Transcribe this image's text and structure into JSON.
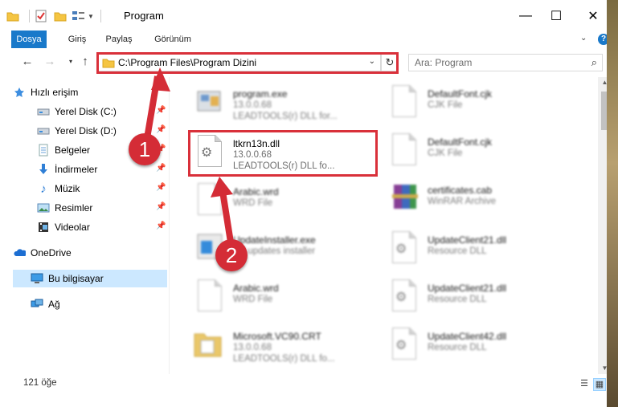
{
  "window": {
    "title": "Program",
    "controls": {
      "minimize": "—",
      "maximize": "☐",
      "close": "✕"
    }
  },
  "ribbon": {
    "tabs": [
      {
        "label": "Dosya",
        "active": true
      },
      {
        "label": "Giriş"
      },
      {
        "label": "Paylaş"
      },
      {
        "label": "Görünüm"
      }
    ],
    "expand_icon": "chevron-down-icon",
    "help_icon": "help-icon"
  },
  "nav": {
    "address": "C:\\Program Files\\Program Dizini",
    "search_placeholder": "Ara: Program"
  },
  "sidebar": {
    "items": [
      {
        "label": "Hızlı erişim",
        "icon": "star-icon"
      },
      {
        "label": "Yerel Disk (C:)",
        "icon": "drive-icon",
        "pinned": true
      },
      {
        "label": "Yerel Disk (D:)",
        "icon": "drive-icon",
        "pinned": true
      },
      {
        "label": "Belgeler",
        "icon": "documents-icon",
        "pinned": true
      },
      {
        "label": "İndirmeler",
        "icon": "download-icon",
        "pinned": true
      },
      {
        "label": "Müzik",
        "icon": "music-icon",
        "pinned": true
      },
      {
        "label": "Resimler",
        "icon": "pictures-icon",
        "pinned": true
      },
      {
        "label": "Videolar",
        "icon": "videos-icon",
        "pinned": true
      },
      {
        "label": "OneDrive",
        "icon": "cloud-icon"
      },
      {
        "label": "Bu bilgisayar",
        "icon": "computer-icon",
        "selected": true
      },
      {
        "label": "Ağ",
        "icon": "network-icon"
      }
    ]
  },
  "files": {
    "left": [
      {
        "name": "program.exe",
        "line2": "13.0.0.68",
        "line3": "LEADTOOLS(r) DLL for...",
        "icon": "exe-icon",
        "blurred": true
      },
      {
        "name": "ltkrn13n.dll",
        "line2": "13.0.0.68",
        "line3": "LEADTOOLS(r) DLL fo...",
        "icon": "dll-gear-icon",
        "blurred": false
      },
      {
        "name": "Arabic.wrd",
        "line2": "WRD File",
        "line3": "",
        "icon": "file-icon",
        "blurred": true
      },
      {
        "name": "UpdateInstaller.exe",
        "line2": "EY updates installer",
        "line3": "",
        "icon": "installer-icon",
        "blurred": true
      },
      {
        "name": "Arabic.wrd",
        "line2": "WRD File",
        "line3": "",
        "icon": "file-icon",
        "blurred": true
      },
      {
        "name": "Microsoft.VC90.CRT",
        "line2": "13.0.0.68",
        "line3": "LEADTOOLS(r) DLL fo...",
        "icon": "folder-icon",
        "blurred": true
      }
    ],
    "right": [
      {
        "name": "DefaultFont.cjk",
        "line2": "CJK File",
        "icon": "file-icon"
      },
      {
        "name": "DefaultFont.cjk",
        "line2": "CJK File",
        "icon": "file-icon"
      },
      {
        "name": "certificates.cab",
        "line2": "WinRAR Archive",
        "icon": "winrar-icon"
      },
      {
        "name": "UpdateClient21.dll",
        "line2": "Resource DLL",
        "icon": "dll-gear-icon"
      },
      {
        "name": "UpdateClient21.dll",
        "line2": "Resource DLL",
        "icon": "dll-gear-icon"
      },
      {
        "name": "UpdateClient42.dll",
        "line2": "Resource DLL",
        "icon": "dll-gear-icon"
      }
    ]
  },
  "status": {
    "count": "121 öğe"
  },
  "annotations": {
    "step1": "1",
    "step2": "2"
  },
  "colors": {
    "accent": "#1979ca",
    "highlight": "#d9303a",
    "selection": "#cce8ff"
  }
}
